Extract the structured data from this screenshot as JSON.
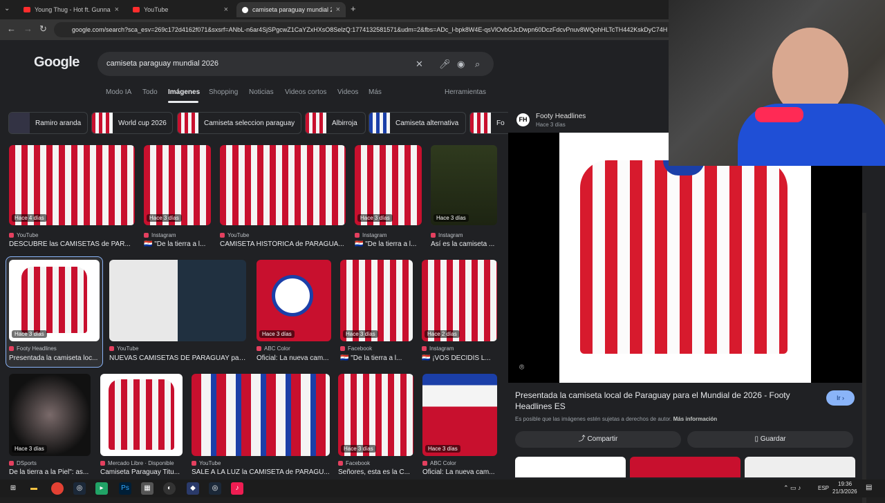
{
  "browser": {
    "tabs": [
      {
        "title": "Young Thug - Hot ft. Gunna"
      },
      {
        "title": "YouTube"
      },
      {
        "title": "camiseta paraguay mundial 2026"
      }
    ],
    "url": "google.com/search?sca_esv=269c172d4162f071&sxsrf=ANbL-n6ar4SjSPgcwZ1CaYZxHXsO8SelzQ:1774132581571&udm=2&fbs=ADc_l-bpk8W4E-qsVlOvbGJcDwpn60DczFdcvPnuv8WQohHLTcTH442KskDyC74H"
  },
  "google": {
    "logo": "Google",
    "query": "camiseta paraguay mundial 2026",
    "nav": [
      "Modo IA",
      "Todo",
      "Imágenes",
      "Shopping",
      "Noticias",
      "Videos cortos",
      "Videos",
      "Más",
      "Herramientas"
    ],
    "chips": [
      "Ramiro aranda",
      "World cup 2026",
      "Camiseta seleccion paraguay",
      "Albirroja",
      "Camiseta alternativa",
      "Fo"
    ],
    "results": [
      {
        "badge": "Hace 4 días",
        "source": "YouTube",
        "title": "DESCUBRE las CAMISETAS de PAR..."
      },
      {
        "badge": "Hace 3 días",
        "source": "Instagram",
        "title": "🇵🇾 \"De la tierra a l..."
      },
      {
        "badge": "",
        "source": "YouTube",
        "title": "CAMISETA HISTÓRICA de PARAGUA..."
      },
      {
        "badge": "Hace 3 días",
        "source": "Instagram",
        "title": "🇵🇾 \"De la tierra a l..."
      },
      {
        "badge": "Hace 3 días",
        "source": "Instagram",
        "title": "Así es la camiseta ..."
      },
      {
        "badge": "Hace 3 días",
        "source": "Footy Headlines",
        "title": "Presentada la camiseta loc..."
      },
      {
        "badge": "",
        "source": "YouTube",
        "title": "NUEVAS CAMISETAS DE PARAGUAY para..."
      },
      {
        "badge": "Hace 3 días",
        "source": "ABC Color",
        "title": "Oficial: La nueva cam..."
      },
      {
        "badge": "Hace 3 días",
        "source": "Facebook",
        "title": "🇵🇾 \"De la tierra a l..."
      },
      {
        "badge": "Hace 2 días",
        "source": "Instagram",
        "title": "🇵🇾 ¡VOS DECIDÍS L..."
      },
      {
        "badge": "Hace 3 días",
        "source": "DSports",
        "title": "De la tierra a la Piel\": as..."
      },
      {
        "badge": "",
        "source": "Mercado Libre · Disponible",
        "title": "Camiseta Paraguay Titu..."
      },
      {
        "badge": "",
        "source": "YouTube",
        "title": "SALE A LA LUZ la CAMISETA de PARAGU..."
      },
      {
        "badge": "Hace 3 días",
        "source": "Facebook",
        "title": "Señores, esta es la C..."
      },
      {
        "badge": "Hace 3 días",
        "source": "ABC Color",
        "title": "Oficial: La nueva cam..."
      }
    ],
    "panel": {
      "site": "Footy Headlines",
      "time": "Hace 3 días",
      "title": "Presentada la camiseta local de Paraguay para el Mundial de 2026 - Footy Headlines ES",
      "go": "Ir",
      "note": "Es posible que las imágenes estén sujetas a derechos de autor.",
      "note_link": "Más información",
      "share": "Compartir",
      "save": "Guardar"
    }
  },
  "taskbar": {
    "lang": "ESP",
    "time": "19:36",
    "date": "21/3/2026"
  }
}
